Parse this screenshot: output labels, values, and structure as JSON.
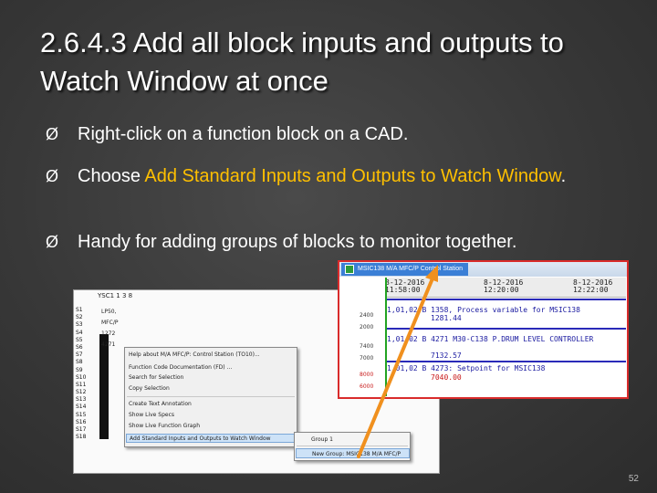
{
  "title": "2.6.4.3  Add all block inputs and outputs to Watch Window at once",
  "bullets": [
    {
      "arrow": "Ø",
      "text": "Right-click on a function block on a CAD."
    },
    {
      "arrow": "Ø",
      "pre": "Choose ",
      "highlight": "Add Standard Inputs and Outputs to Watch Window",
      "post": "."
    },
    {
      "arrow": "Ø",
      "text": "Handy for adding groups of blocks to monitor together."
    }
  ],
  "cad": {
    "header": "YSC1 1 3 8",
    "pins": [
      "S1",
      "S2",
      "S3",
      "S4",
      "S5",
      "S6",
      "S7",
      "S8",
      "S9",
      "S10",
      "S11",
      "S12",
      "S13",
      "S14",
      "S15",
      "S16",
      "S17",
      "S18"
    ],
    "block_values": [
      "LP50,",
      "1272",
      "4271"
    ],
    "block_label": "MFC/P"
  },
  "context_menu": {
    "items": [
      "Help about M/A MFC/P: Control Station (TO10)...",
      "Function Code Documentation (FD) ...",
      "Search for Selection",
      "Copy Selection",
      "Create Text Annotation",
      "Show Live Specs",
      "Show Live Function Graph",
      "Add Standard Inputs and Outputs to Watch Window"
    ],
    "selected": "Add Standard Inputs and Outputs to Watch Window"
  },
  "submenu": {
    "items": [
      "Group 1",
      "New Group: MSIC138 M/A MFC/P"
    ],
    "selected": "New Group: MSIC138 M/A MFC/P"
  },
  "station": {
    "tab_label": "MSIC138 M/A MFC/P Control Station",
    "timestamps": [
      {
        "date": "8-12-2016",
        "time": "11:58:00"
      },
      {
        "date": "8-12-2016",
        "time": "12:20:00"
      },
      {
        "date": "8-12-2016",
        "time": "12:22:00"
      }
    ],
    "y_labels_top": [
      "2400",
      "2000"
    ],
    "y_labels_mid": [
      "7400",
      "7000"
    ],
    "y_labels_bottom": [
      "8000",
      "6000"
    ],
    "series": [
      {
        "label": "1,01,02 B 1358, Process variable for MSIC138",
        "value": "1281.44"
      },
      {
        "label": "1,01,02 B 4271 M30-C138   P.DRUM LEVEL   CONTROLLER",
        "value": "7132.57"
      },
      {
        "label": "1,01,02 B 4273: Setpoint for MSIC138",
        "value": "7040.00"
      }
    ]
  },
  "annotation": {
    "arrow_color": "#f0901e"
  },
  "page_number": "52"
}
